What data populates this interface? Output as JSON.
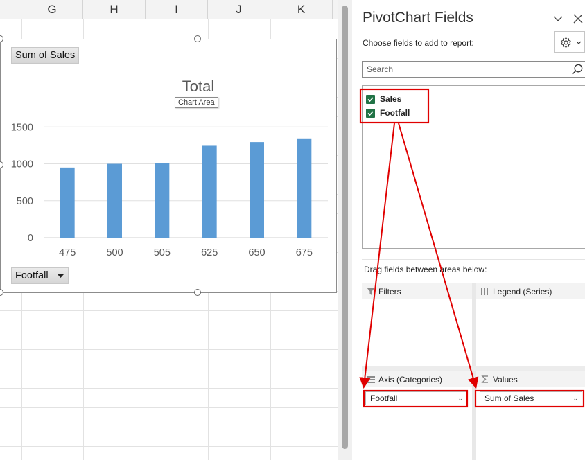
{
  "sheet": {
    "columns": [
      "G",
      "H",
      "I",
      "J",
      "K"
    ]
  },
  "chart": {
    "value_field_button": "Sum of Sales",
    "axis_field_button": "Footfall",
    "tooltip": "Chart Area"
  },
  "chart_data": {
    "type": "bar",
    "title": "Total",
    "categories": [
      "475",
      "500",
      "505",
      "625",
      "650",
      "675"
    ],
    "series": [
      {
        "values": [
          950,
          1000,
          1010,
          1245,
          1295,
          1345
        ]
      }
    ],
    "y_ticks": [
      "1500",
      "1000",
      "500",
      "0"
    ],
    "ylim": [
      0,
      1700
    ],
    "xlabel": "",
    "ylabel": "",
    "grid": true,
    "legend": "none",
    "bar_color": "#5b9bd5"
  },
  "pane": {
    "title": "PivotChart Fields",
    "subtitle": "Choose fields to add to report:",
    "search_placeholder": "Search",
    "fields": [
      {
        "label": "Sales",
        "checked": true
      },
      {
        "label": "Footfall",
        "checked": true
      }
    ],
    "drag_label": "Drag fields between areas below:",
    "areas": {
      "filters": {
        "title": "Filters"
      },
      "legend": {
        "title": "Legend (Series)"
      },
      "axis": {
        "title": "Axis (Categories)",
        "item": "Footfall"
      },
      "values": {
        "title": "Values",
        "item": "Sum of Sales"
      }
    }
  },
  "colors": {
    "accent_green": "#217346",
    "annotation_red": "#e00000",
    "bar_blue": "#5b9bd5"
  }
}
